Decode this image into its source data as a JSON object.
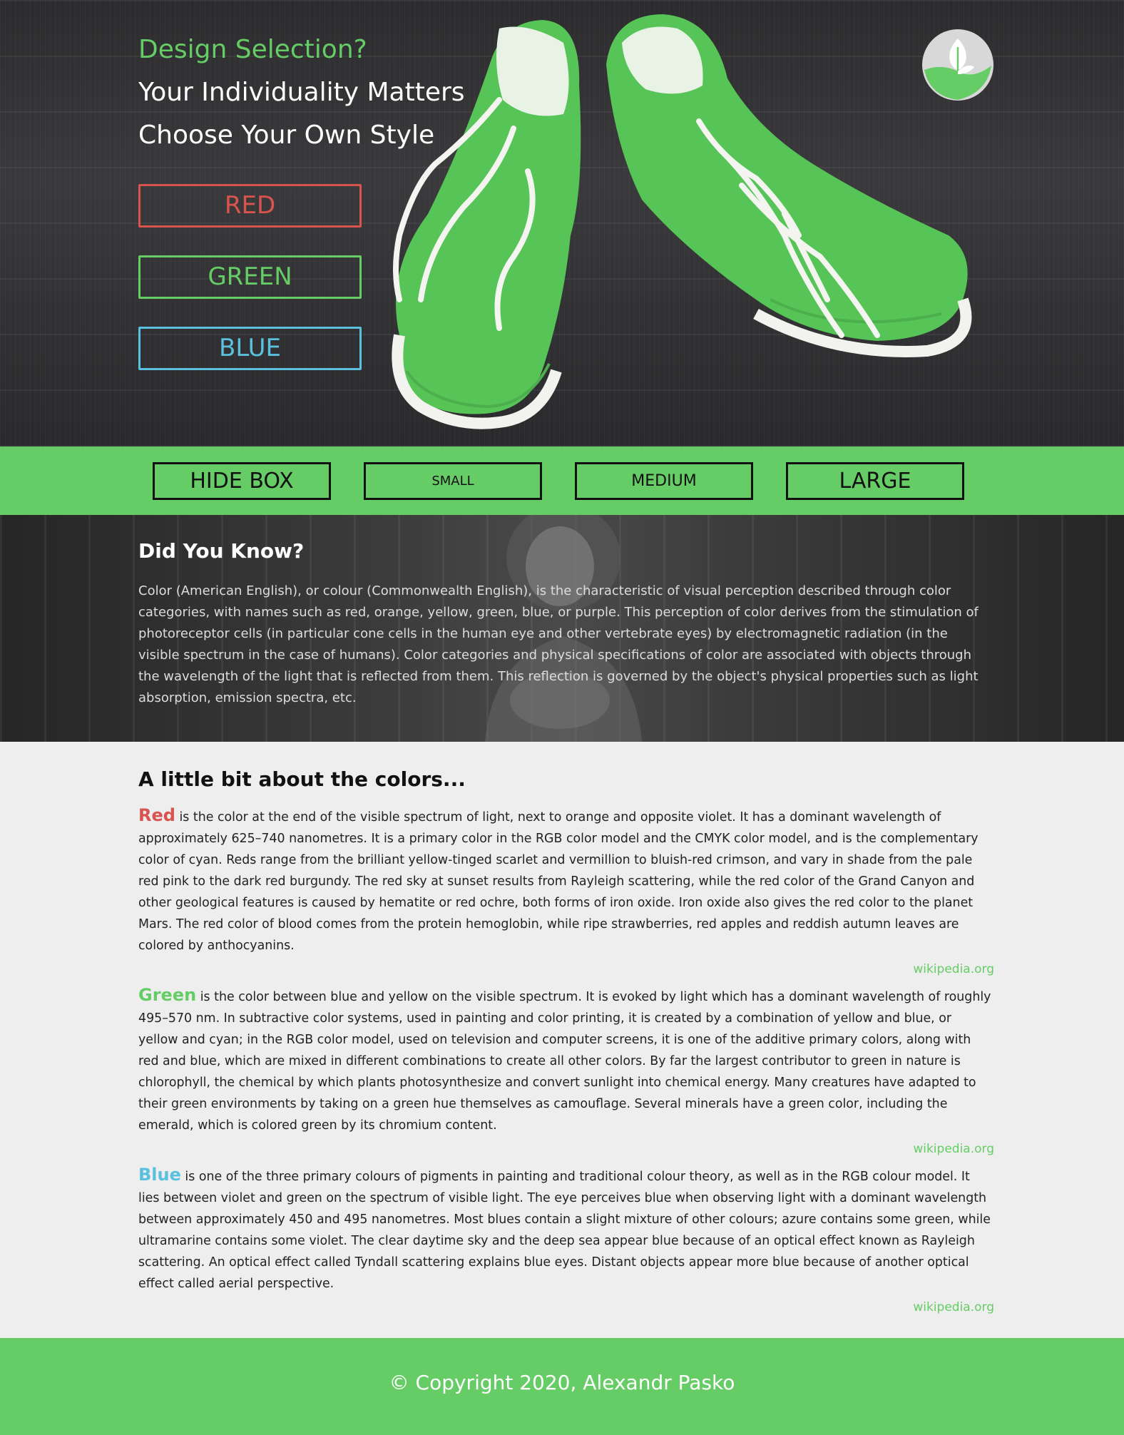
{
  "hero": {
    "line1": "Design Selection?",
    "line2": "Your Individuality Matters",
    "line3": "Choose Your Own Style"
  },
  "color_buttons": {
    "red": "RED",
    "green": "GREEN",
    "blue": "BLUE"
  },
  "logo": {
    "icon": "leaf-in-hand-logo",
    "color": "#66cc66"
  },
  "size_buttons": {
    "hide": "HIDE BOX",
    "small": "SMALL",
    "medium": "MEDIUM",
    "large": "LARGE"
  },
  "did_you_know": {
    "title": "Did You Know?",
    "text": "Color (American English), or colour (Commonwealth English), is the characteristic of visual perception described through color categories, with names such as red, orange, yellow, green, blue, or purple. This perception of color derives from the stimulation of photoreceptor cells (in particular cone cells in the human eye and other vertebrate eyes) by electromagnetic radiation (in the visible spectrum in the case of humans). Color categories and physical specifications of color are associated with objects through the wavelength of the light that is reflected from them. This reflection is governed by the object's physical properties such as light absorption, emission spectra, etc."
  },
  "colors_section": {
    "title": "A little bit about the colors...",
    "red": {
      "name": "Red",
      "text": " is the color at the end of the visible spectrum of light, next to orange and opposite violet. It has a dominant wavelength of approximately 625–740 nanometres. It is a primary color in the RGB color model and the CMYK color model, and is the complementary color of cyan. Reds range from the brilliant yellow-tinged scarlet and vermillion to bluish-red crimson, and vary in shade from the pale red pink to the dark red burgundy. The red sky at sunset results from Rayleigh scattering, while the red color of the Grand Canyon and other geological features is caused by hematite or red ochre, both forms of iron oxide. Iron oxide also gives the red color to the planet Mars. The red color of blood comes from the protein hemoglobin, while ripe strawberries, red apples and reddish autumn leaves are colored by anthocyanins.",
      "source": "wikipedia.org"
    },
    "green": {
      "name": "Green",
      "text": " is the color between blue and yellow on the visible spectrum. It is evoked by light which has a dominant wavelength of roughly 495–570 nm. In subtractive color systems, used in painting and color printing, it is created by a combination of yellow and blue, or yellow and cyan; in the RGB color model, used on television and computer screens, it is one of the additive primary colors, along with red and blue, which are mixed in different combinations to create all other colors. By far the largest contributor to green in nature is chlorophyll, the chemical by which plants photosynthesize and convert sunlight into chemical energy. Many creatures have adapted to their green environments by taking on a green hue themselves as camouflage. Several minerals have a green color, including the emerald, which is colored green by its chromium content.",
      "source": "wikipedia.org"
    },
    "blue": {
      "name": "Blue",
      "text": " is one of the three primary colours of pigments in painting and traditional colour theory, as well as in the RGB colour model. It lies between violet and green on the spectrum of visible light. The eye perceives blue when observing light with a dominant wavelength between approximately 450 and 495 nanometres. Most blues contain a slight mixture of other colours; azure contains some green, while ultramarine contains some violet. The clear daytime sky and the deep sea appear blue because of an optical effect known as Rayleigh scattering. An optical effect called Tyndall scattering explains blue eyes. Distant objects appear more blue because of another optical effect called aerial perspective.",
      "source": "wikipedia.org"
    }
  },
  "footer": {
    "text": "© Copyright 2020, Alexandr Pasko"
  },
  "theme": {
    "accent": "#66cc66",
    "red": "#d9534f",
    "blue": "#5bc0de"
  }
}
